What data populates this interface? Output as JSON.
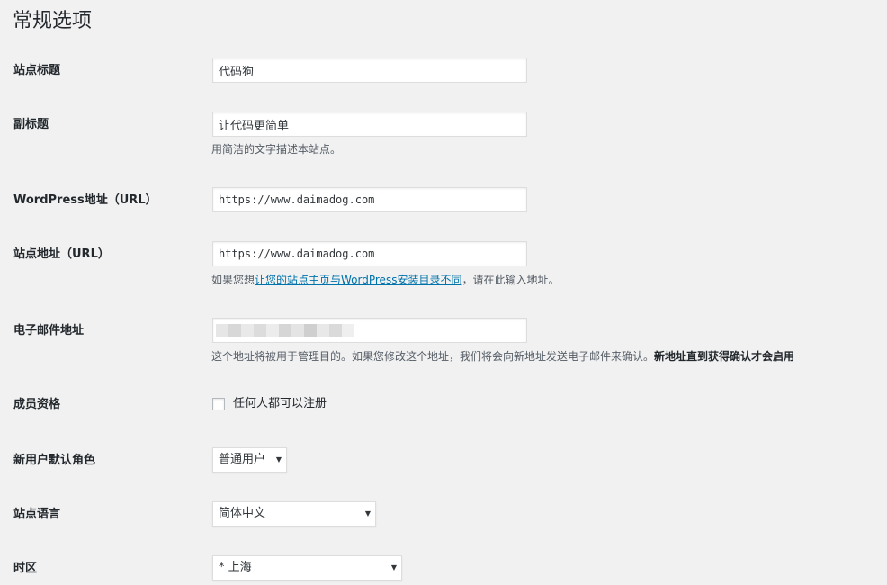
{
  "page": {
    "title": "常规选项"
  },
  "fields": {
    "site_title": {
      "label": "站点标题",
      "value": "代码狗"
    },
    "tagline": {
      "label": "副标题",
      "value": "让代码更简单",
      "description": "用简洁的文字描述本站点。"
    },
    "wp_url": {
      "label": "WordPress地址（URL）",
      "value": "https://www.daimadog.com"
    },
    "site_url": {
      "label": "站点地址（URL）",
      "value": "https://www.daimadog.com",
      "description_prefix": "如果您想",
      "description_link": "让您的站点主页与WordPress安装目录不同",
      "description_suffix": "，请在此输入地址。"
    },
    "email": {
      "label": "电子邮件地址",
      "description_prefix": "这个地址将被用于管理目的。如果您修改这个地址，我们将会向新地址发送电子邮件来确认。",
      "description_bold": "新地址直到获得确认才会启用"
    },
    "membership": {
      "label": "成员资格",
      "checkbox_label": "任何人都可以注册",
      "checked": false
    },
    "default_role": {
      "label": "新用户默认角色",
      "value": "普通用户"
    },
    "site_language": {
      "label": "站点语言",
      "value": "简体中文"
    },
    "timezone": {
      "label": "时区",
      "value": "* 上海"
    }
  },
  "icons": {
    "select_arrow": "triangle-down"
  },
  "colors": {
    "background": "#f1f1f1",
    "link": "#0073aa",
    "text": "#23282d",
    "description": "#555d66"
  }
}
